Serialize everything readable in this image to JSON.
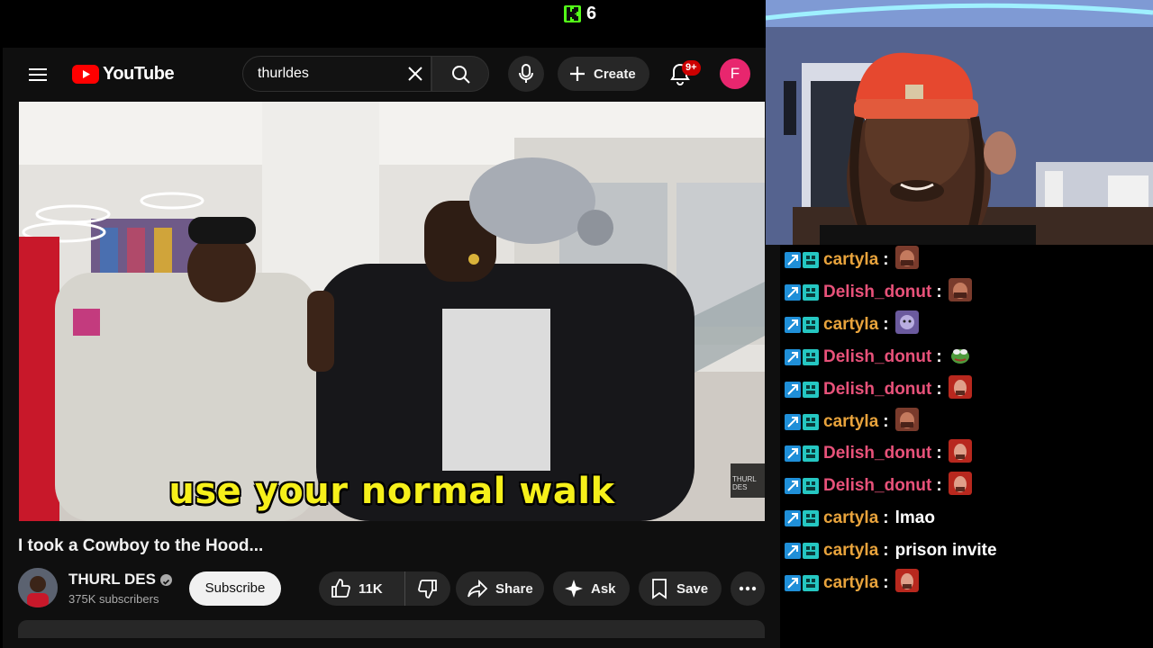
{
  "kick": {
    "viewer_count": "6"
  },
  "youtube": {
    "logo_text": "YouTube",
    "search": {
      "value": "thurldes",
      "placeholder": "Search"
    },
    "create_label": "Create",
    "notification_badge": "9+",
    "account_initial": "F"
  },
  "video": {
    "caption": "use your normal walk",
    "watermark": "THURL DES",
    "title": "I took a Cowboy to the Hood...",
    "channel_name": "THURL DES",
    "subscriber_count": "375K subscribers",
    "subscribe_label": "Subscribe",
    "like_count": "11K",
    "share_label": "Share",
    "ask_label": "Ask",
    "save_label": "Save"
  },
  "chat": {
    "messages": [
      {
        "user": "cartyla",
        "color": "#e8a33c",
        "text": "",
        "emote": "gigachad-emote"
      },
      {
        "user": "Delish_donut",
        "color": "#e8527a",
        "text": "",
        "emote": "gigachad-emote"
      },
      {
        "user": "cartyla",
        "color": "#e8a33c",
        "text": "",
        "emote": "purple-face-emote"
      },
      {
        "user": "Delish_donut",
        "color": "#e8527a",
        "text": "",
        "emote": "pepe-emote"
      },
      {
        "user": "Delish_donut",
        "color": "#e8527a",
        "text": "",
        "emote": "red-face-emote"
      },
      {
        "user": "cartyla",
        "color": "#e8a33c",
        "text": "",
        "emote": "gigachad-emote"
      },
      {
        "user": "Delish_donut",
        "color": "#e8527a",
        "text": "",
        "emote": "red-face-emote"
      },
      {
        "user": "Delish_donut",
        "color": "#e8527a",
        "text": "",
        "emote": "red-face-emote"
      },
      {
        "user": "cartyla",
        "color": "#e8a33c",
        "text": "lmao",
        "emote": ""
      },
      {
        "user": "cartyla",
        "color": "#e8a33c",
        "text": "prison invite",
        "emote": ""
      },
      {
        "user": "cartyla",
        "color": "#e8a33c",
        "text": "",
        "emote": "red-face-emote"
      }
    ]
  },
  "colors": {
    "kick_green": "#53fc18",
    "youtube_red": "#ff0000",
    "caption_yellow": "#f6f01a",
    "avatar_pink": "#e8266e"
  }
}
